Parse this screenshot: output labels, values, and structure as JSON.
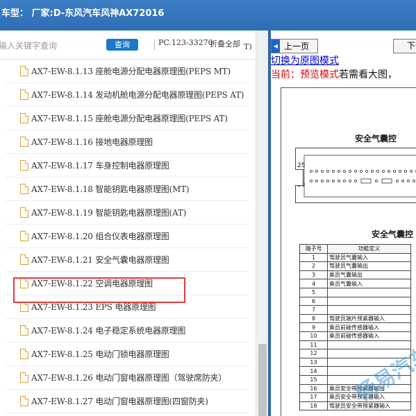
{
  "title_bar": {
    "text": "车型： 厂家:D-东风汽车风神AX72016"
  },
  "search": {
    "placeholder": "输入关键字查询",
    "button_label": "查询",
    "code": "PC.123-33270",
    "collapse_label": "折叠全部",
    "collapse_tail": "T)"
  },
  "tree": {
    "selected_index": 8,
    "items": [
      {
        "label": "AX7-EW-8.1.13 座舱电源分配电器原理图(PEPS MT)"
      },
      {
        "label": "AX7-EW-8.1.14 发动机舱电源分配电器原理图(PEPS AT)"
      },
      {
        "label": "AX7-EW-8.1.15 座舱电源分配电器原理图(PEPS AT)"
      },
      {
        "label": "AX7-EW-8.1.16 接地电器原理图"
      },
      {
        "label": "AX7-EW-8.1.17 车身控制电器原理图"
      },
      {
        "label": "AX7-EW-8.1.18 智能钥匙电器原理图(MT)"
      },
      {
        "label": "AX7-EW-8.1.19 智能钥匙电器原理图(AT)"
      },
      {
        "label": "AX7-EW-8.1.20 组合仪表电器原理图"
      },
      {
        "label": "AX7-EW-8.1.21 安全气囊电器原理图"
      },
      {
        "label": "AX7-EW-8.1.22 空调电器原理图"
      },
      {
        "label": "AX7-EW-8.1.23 EPS 电器原理图"
      },
      {
        "label": "AX7-EW-8.1.24 电子稳定系统电器原理图"
      },
      {
        "label": "AX7-EW-8.1.25 电动门锁电器原理图"
      },
      {
        "label": "AX7-EW-8.1.26 电动门窗电器原理图（驾驶席防夹）"
      },
      {
        "label": "AX7-EW-8.1.27 电动门窗电器原理图(四窗防夹)"
      }
    ]
  },
  "viewer": {
    "prev_label": "上一页",
    "next_label": "下一",
    "switch_link": "切换为原图模式",
    "mode_prefix": "当前：预览模式",
    "mode_suffix": "若需看大图，",
    "doc_title": "安全气囊控",
    "connector_pin_top": "25",
    "connector_pin_bottom": "50",
    "table_title": "安全气囊控",
    "table_headers": [
      "端子号",
      "功能定义"
    ],
    "table_rows": [
      [
        "1",
        "驾驶员气囊输入"
      ],
      [
        "2",
        "驾驶员气囊输出"
      ],
      [
        "3",
        "乘员气囊输出"
      ],
      [
        "4",
        "乘员气囊输入"
      ],
      [
        "5",
        ""
      ],
      [
        "6",
        ""
      ],
      [
        "7",
        ""
      ],
      [
        "8",
        "驾驶员端片预紧器输入"
      ],
      [
        "9",
        "乘员前碰传感器输入"
      ],
      [
        "10",
        "乘员前碰传感器输入"
      ],
      [
        "11",
        ""
      ],
      [
        "12",
        ""
      ],
      [
        "13",
        ""
      ],
      [
        "14",
        ""
      ],
      [
        "15",
        ""
      ],
      [
        "16",
        "乘员安全带预紧器输出"
      ],
      [
        "17",
        "乘员安全带预紧器输入"
      ],
      [
        "18",
        "驾驶员安全带预紧器输入"
      ]
    ],
    "watermark": "畅易汽车"
  },
  "colors": {
    "title_bar": "#2d6db5",
    "search_button": "#1e78c8",
    "highlight_border": "#e03a3a",
    "divider": "#2b66b0",
    "link": "#0000cc",
    "mode_red": "#e00000"
  }
}
